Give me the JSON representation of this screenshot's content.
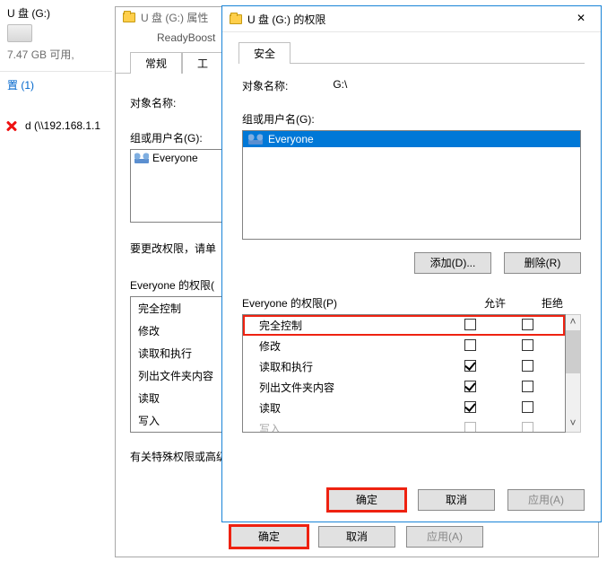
{
  "explorer": {
    "usb_label": "U 盘 (G:)",
    "usb_free": "7.47 GB 可用,",
    "crumb": "置 (1)",
    "net_drive": "d (\\\\192.168.1.1"
  },
  "props": {
    "title": "U 盘 (G:) 属性",
    "status": "ReadyBoost",
    "tab_general": "常规",
    "tab_tools": "工",
    "obj_name_label": "对象名称:",
    "groups_label": "组或用户名(G):",
    "group_everyone": "Everyone",
    "change_hint": "要更改权限，请单",
    "perm_header": "Everyone 的权限(",
    "perm_items": [
      "完全控制",
      "修改",
      "读取和执行",
      "列出文件夹内容",
      "读取",
      "写入"
    ],
    "advanced_hint": "有关特殊权限或高级",
    "btn_ok": "确定",
    "btn_cancel": "取消",
    "btn_apply": "应用(A)"
  },
  "perms": {
    "title": "U 盘 (G:) 的权限",
    "tab_security": "安全",
    "obj_name_label": "对象名称:",
    "obj_name_value": "G:\\",
    "groups_label": "组或用户名(G):",
    "group_everyone": "Everyone",
    "btn_add": "添加(D)...",
    "btn_remove": "删除(R)",
    "perm_header": "Everyone 的权限(P)",
    "col_allow": "允许",
    "col_deny": "拒绝",
    "rows": [
      {
        "label": "完全控制",
        "allow": false,
        "deny": false
      },
      {
        "label": "修改",
        "allow": false,
        "deny": false
      },
      {
        "label": "读取和执行",
        "allow": true,
        "deny": false
      },
      {
        "label": "列出文件夹内容",
        "allow": true,
        "deny": false
      },
      {
        "label": "读取",
        "allow": true,
        "deny": false
      },
      {
        "label": "写入",
        "allow": false,
        "deny": false
      }
    ],
    "btn_ok": "确定",
    "btn_cancel": "取消",
    "btn_apply": "应用(A)"
  }
}
